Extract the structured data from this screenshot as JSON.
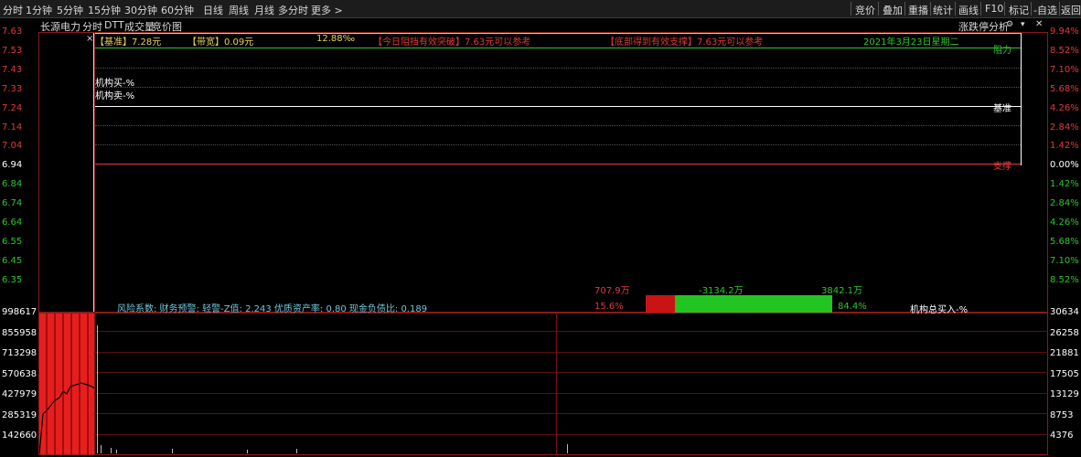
{
  "toolbar": {
    "tabs": [
      "分时",
      "1分钟",
      "5分钟",
      "15分钟",
      "30分钟",
      "60分钟",
      "日线",
      "周线",
      "月线",
      "多分时",
      "更多 >"
    ],
    "right_buttons": [
      "竞价",
      "叠加",
      "重播",
      "统计",
      "画线",
      "F10",
      "标记",
      "-自选",
      "返回"
    ]
  },
  "subbar": {
    "stock_name": "长源电力",
    "chart_tabs": [
      "分时",
      "DTT",
      "成交量",
      "竞价图"
    ],
    "right_label": "涨跌停分析"
  },
  "price_axis": {
    "left_ticks": [
      "7.63",
      "7.53",
      "7.43",
      "7.33",
      "7.24",
      "7.14",
      "7.04",
      "6.94",
      "6.84",
      "6.74",
      "6.64",
      "6.55",
      "6.45",
      "6.35"
    ],
    "right_ticks": [
      "9.94%",
      "8.52%",
      "7.10%",
      "5.68%",
      "4.26%",
      "2.84%",
      "1.42%",
      "0.00%",
      "1.42%",
      "2.84%",
      "4.26%",
      "5.68%",
      "7.10%",
      "8.52%"
    ]
  },
  "info_row": {
    "base_price": "【基准】7.28元",
    "band": "【带宽】0.09元",
    "pct": "12.88‰",
    "today_break": "【今日阻挡有效突破】7.63元可以参考",
    "bottom_support": "【底部得到有效支撑】7.63元可以参考",
    "date": "2021年3月23日星期二"
  },
  "levels": {
    "resistance": "阻力",
    "base": "基准",
    "support": "支撑"
  },
  "institution": {
    "buy": "机构买-%",
    "sell": "机构卖-%",
    "total_buy": "机构总买入-%"
  },
  "risk_line": "风险系数: 财务预警: 轻警-Z值: 2.243 优质资产率: 0.80 现金负债比: 0.189",
  "flow": {
    "red_value": "707.9万",
    "net_value": "-3134.2万",
    "green_value": "3842.1万",
    "red_pct": "15.6%",
    "green_pct": "84.4%",
    "red_ratio": 0.156,
    "green_ratio": 0.844
  },
  "volume_axis": {
    "left_ticks": [
      "998617",
      "855958",
      "713298",
      "570638",
      "427979",
      "285319",
      "142660"
    ],
    "right_ticks": [
      "30634",
      "26258",
      "21881",
      "17505",
      "13129",
      "8753",
      "4376"
    ]
  },
  "colors": {
    "up": "#e03a3a",
    "down": "#2ec52e",
    "resistance_line": "#2ec52e",
    "support_line": "#e03a3a",
    "base_line": "#ffffff",
    "frame": "#8a1a1a"
  }
}
